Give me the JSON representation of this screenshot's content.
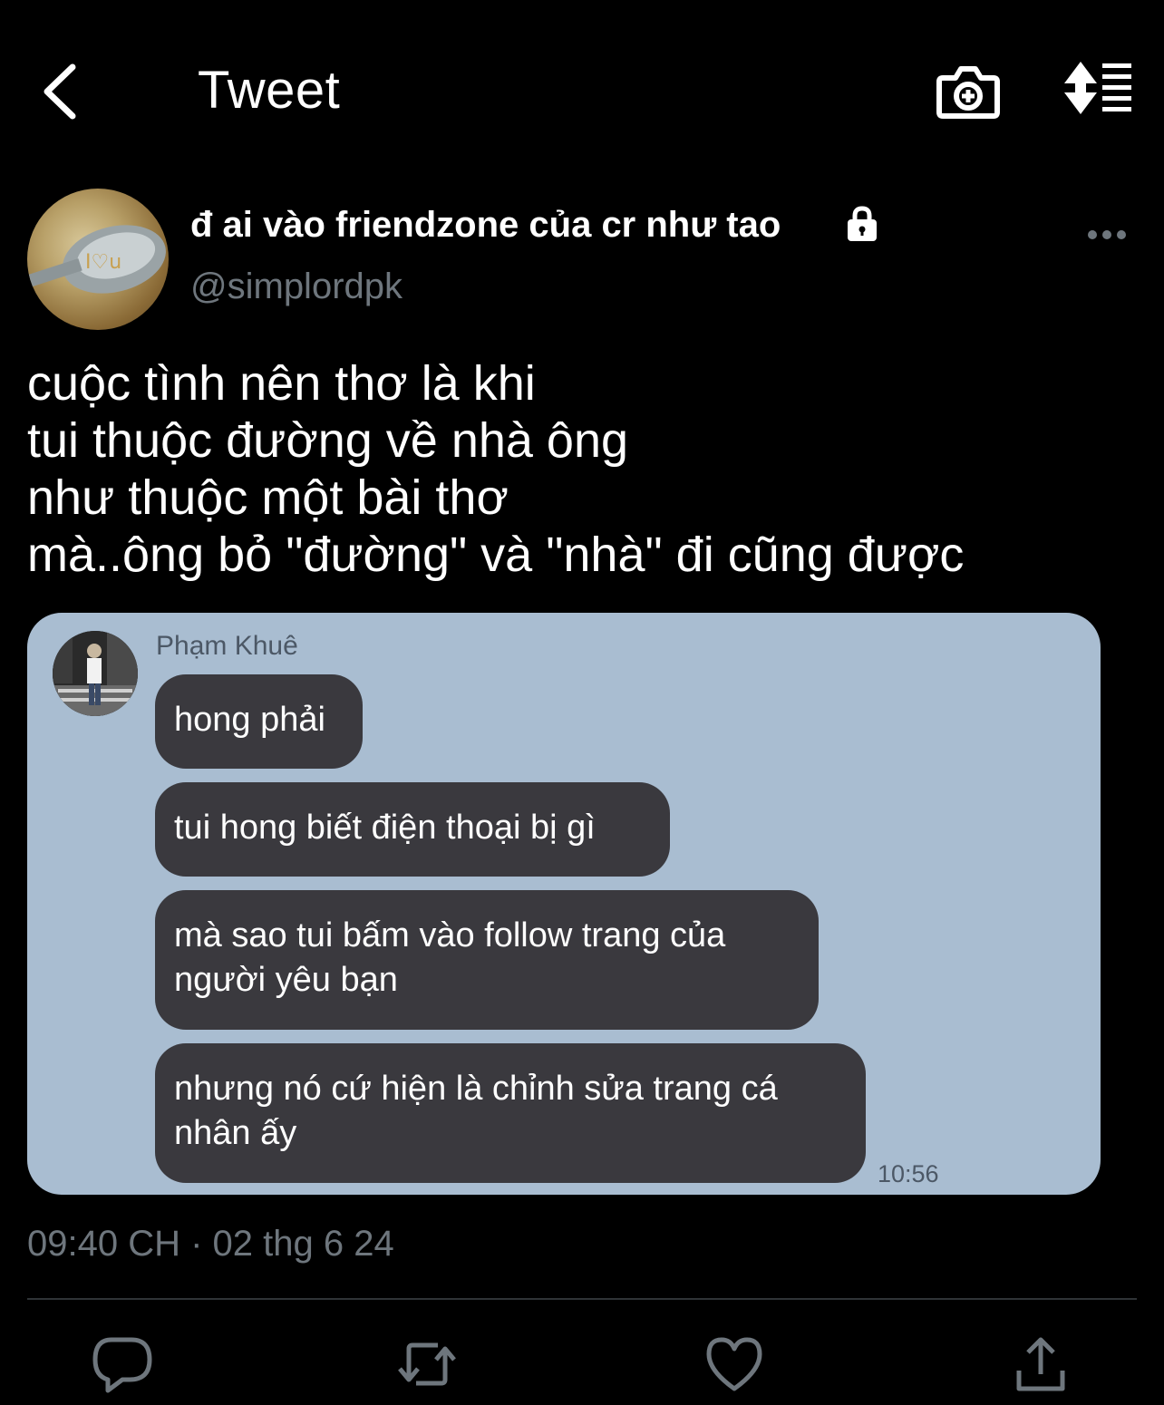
{
  "header": {
    "title": "Tweet",
    "back_icon": "chevron-left-icon",
    "camera_icon": "camera-add-icon",
    "sort_icon": "sort-list-icon"
  },
  "author": {
    "display_name": "đ ai vào friendzone của cr như tao",
    "handle": "@simplordpk",
    "protected_icon": "lock-icon"
  },
  "tweet": {
    "lines": [
      "cuộc tình nên thơ là khi",
      "tui thuộc đường về nhà ông",
      "như thuộc một bài thơ",
      "mà..ông bỏ \"đường\" và \"nhà\" đi cũng được"
    ],
    "timestamp": "09:40 CH · 02 thg 6 24"
  },
  "media": {
    "background_color": "#a9bdd1",
    "bubble_color": "#3a393e",
    "sender_name": "Phạm Khuê",
    "messages": [
      "hong phải",
      "tui hong biết điện thoại bị gì",
      "mà sao tui bấm vào follow trang của người yêu bạn",
      "nhưng nó cứ hiện là chỉnh sửa trang cá nhân ấy"
    ],
    "time": "10:56"
  },
  "actions": {
    "reply_icon": "reply-icon",
    "retweet_icon": "retweet-icon",
    "like_icon": "heart-icon",
    "share_icon": "share-icon"
  },
  "colors": {
    "background": "#000000",
    "text_primary": "#ffffff",
    "text_secondary": "#6e767d",
    "divider": "#2f3336"
  }
}
